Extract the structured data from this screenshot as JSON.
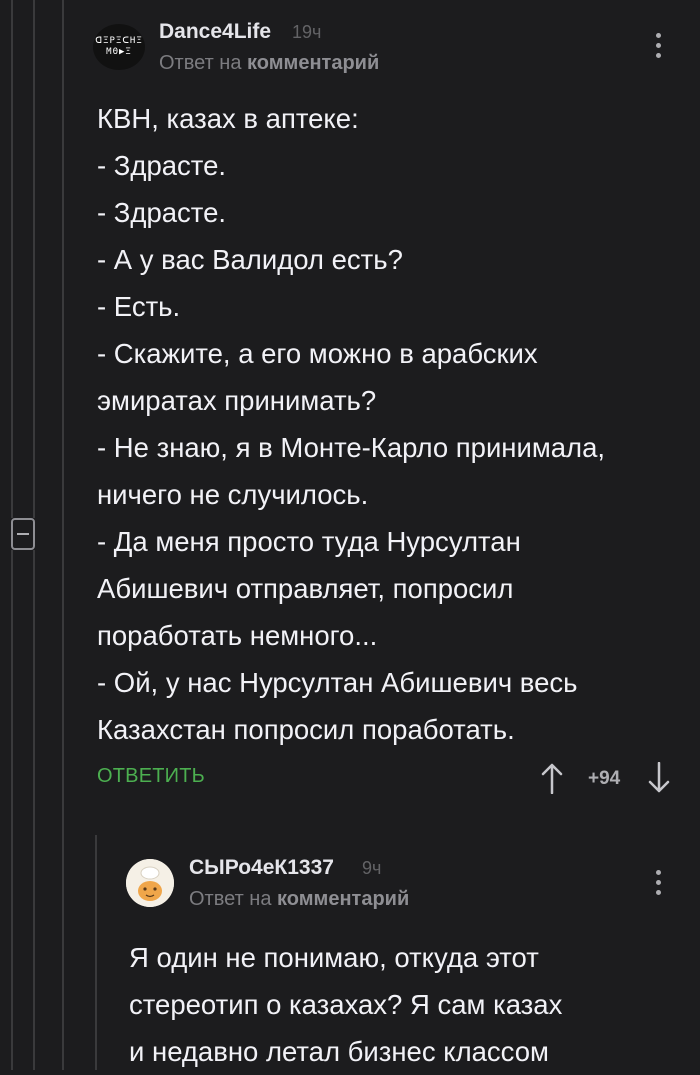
{
  "comment1": {
    "avatar_text": [
      "ᗡΞPΞᑕHΞ",
      "MΘ▶Ξ"
    ],
    "username": "Dance4Life",
    "time": "19ч",
    "reply_prefix": "Ответ на",
    "reply_target": "комментарий",
    "text": "КВН, казах в аптеке:\n- Здрасте.\n- Здрасте.\n- А у вас Валидол есть?\n- Есть.\n- Скажите, а его можно в арабских\nэмиратах принимать?\n- Не знаю, я в Монте-Карло принимала,\nничего не случилось.\n- Да меня просто туда Нурсултан\nАбишевич отправляет, попросил\nпоработать немного...\n- Ой, у нас Нурсултан Абишевич весь\nКазахстан попросил поработать.",
    "reply_button": "ОТВЕТИТЬ",
    "score": "+94"
  },
  "comment2": {
    "username": "СЫРо4еК1337",
    "time": "9ч",
    "reply_prefix": "Ответ на",
    "reply_target": "комментарий",
    "text": "Я один не понимаю, откуда этот\nстереотип о казахах? Я сам казах\nи недавно летал бизнес классом"
  },
  "icons": {
    "more": "more-vertical-icon",
    "upvote": "arrow-up-icon",
    "downvote": "arrow-down-icon",
    "collapse": "minus-square-icon"
  },
  "colors": {
    "background": "#1c1c1e",
    "accent": "#4caf50",
    "thread_line": "#3a3a3c"
  }
}
